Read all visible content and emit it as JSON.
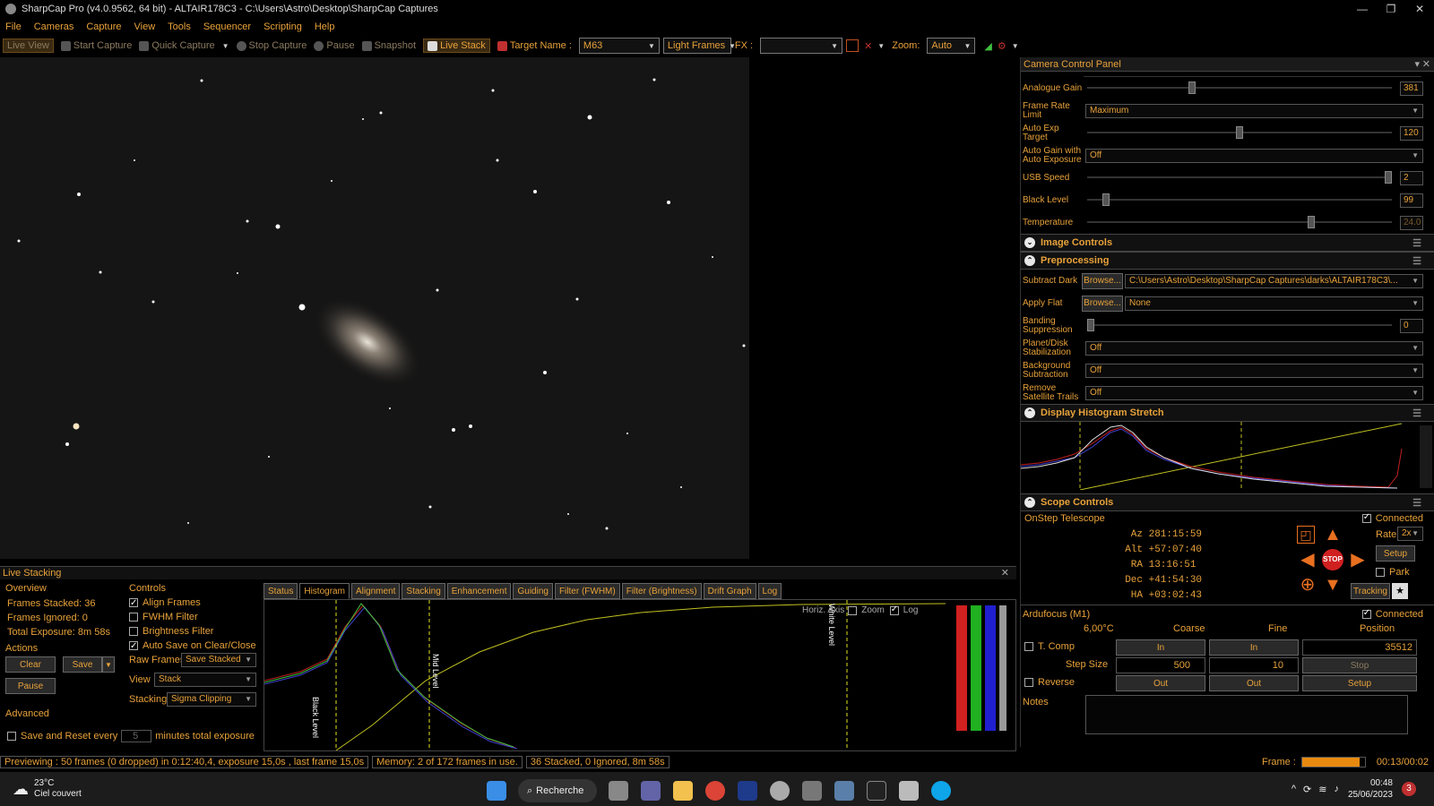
{
  "window": {
    "title": "SharpCap Pro (v4.0.9562, 64 bit) - ALTAIR178C3 - C:\\Users\\Astro\\Desktop\\SharpCap Captures",
    "controls": [
      "—",
      "❐",
      "✕"
    ]
  },
  "menu": [
    "File",
    "Cameras",
    "Capture",
    "View",
    "Tools",
    "Sequencer",
    "Scripting",
    "Help"
  ],
  "toolbar": {
    "live_view": "Live View",
    "start_capture": "Start Capture",
    "quick_capture": "Quick Capture",
    "stop_capture": "Stop Capture",
    "pause": "Pause",
    "snapshot": "Snapshot",
    "live_stack": "Live Stack",
    "target_label": "Target Name :",
    "target_value": "M63",
    "frame_type": "Light Frames",
    "fx_label": "FX :",
    "fx_value": "",
    "zoom_label": "Zoom:",
    "zoom_value": "Auto"
  },
  "camera_panel": {
    "title": "Camera Control Panel",
    "analogue_gain": {
      "label": "Analogue Gain",
      "value": "381",
      "level": 0.34
    },
    "frame_rate": {
      "label": "Frame Rate Limit",
      "value": "Maximum"
    },
    "auto_exp": {
      "label": "Auto Exp Target",
      "value": "120",
      "level": 0.5
    },
    "auto_gain": {
      "label": "Auto Gain with Auto Exposure",
      "value": "Off"
    },
    "usb_speed": {
      "label": "USB Speed",
      "value": "2",
      "level": 1.0
    },
    "black_level": {
      "label": "Black Level",
      "value": "99",
      "level": 0.05
    },
    "temperature": {
      "label": "Temperature",
      "value": "24.0",
      "level": 0.74
    }
  },
  "image_controls": {
    "title": "Image Controls"
  },
  "preprocessing": {
    "title": "Preprocessing",
    "subtract_dark": {
      "label": "Subtract Dark",
      "button": "Browse...",
      "value": "C:\\Users\\Astro\\Desktop\\SharpCap Captures\\darks\\ALTAIR178C3\\..."
    },
    "apply_flat": {
      "label": "Apply Flat",
      "button": "Browse...",
      "value": "None"
    },
    "banding": {
      "label": "Banding Suppression",
      "value": "0",
      "level": 0.0
    },
    "planet": {
      "label": "Planet/Disk Stabilization",
      "value": "Off"
    },
    "background": {
      "label": "Background Subtraction",
      "value": "Off"
    },
    "satellite": {
      "label": "Remove Satellite Trails",
      "value": "Off"
    }
  },
  "histogram_stretch": {
    "title": "Display Histogram Stretch"
  },
  "scope": {
    "title": "Scope Controls",
    "telescope": "OnStep Telescope",
    "connected": "Connected",
    "az_label": "Az",
    "az": "281:15:59",
    "alt_label": "Alt",
    "alt": "+57:07:40",
    "ra_label": "RA",
    "ra": "13:16:51",
    "dec_label": "Dec",
    "dec": "+41:54:30",
    "ha_label": "HA",
    "ha": "+03:02:43",
    "rate_label": "Rate:",
    "rate": "2x",
    "setup": "Setup",
    "park": "Park",
    "tracking": "Tracking",
    "stop": "STOP"
  },
  "focuser": {
    "title": "Ardufocus (M1)",
    "connected": "Connected",
    "temp": "6,00°C",
    "coarse": "Coarse",
    "fine": "Fine",
    "position": "Position",
    "tcomp": "T. Comp",
    "in": "In",
    "position_value": "35512",
    "step_size_label": "Step Size",
    "coarse_step": "500",
    "fine_step": "10",
    "stop": "Stop",
    "reverse": "Reverse",
    "out": "Out",
    "setup": "Setup",
    "notes": "Notes"
  },
  "live_stacking": {
    "title": "Live Stacking",
    "overview": "Overview",
    "frames_stacked": "Frames Stacked: 36",
    "frames_ignored": "Frames Ignored: 0",
    "total_exposure": "Total Exposure:  8m 58s",
    "actions": "Actions",
    "clear": "Clear",
    "save": "Save",
    "pause": "Pause",
    "advanced": "Advanced",
    "save_reset_label": "Save and Reset every",
    "save_reset_value": "5",
    "save_reset_suffix": "minutes total exposure",
    "controls": "Controls",
    "align_frames": "Align Frames",
    "fwhm_filter": "FWHM Filter",
    "brightness_filter": "Brightness Filter",
    "auto_save": "Auto Save on Clear/Close",
    "raw_frames_label": "Raw Frames",
    "raw_frames_value": "Save Stacked",
    "view_label": "View",
    "view_value": "Stack",
    "stacking_label": "Stacking",
    "stacking_value": "Sigma Clipping",
    "tabs": [
      "Status",
      "Histogram",
      "Alignment",
      "Stacking",
      "Enhancement",
      "Guiding",
      "Filter (FWHM)",
      "Filter (Brightness)",
      "Drift Graph",
      "Log"
    ],
    "horiz_axis": "Horiz. Axis",
    "zoom": "Zoom",
    "log": "Log",
    "black_level": "Black Level",
    "mid_level": "Mid Level",
    "white_level": "White Level"
  },
  "status": {
    "preview": "Previewing : 50 frames (0 dropped) in 0:12:40,4, exposure 15,0s , last frame 15,0s",
    "memory": "Memory: 2 of 172 frames in use.",
    "stacked": "36 Stacked, 0 Ignored, 8m 58s",
    "frame_label": "Frame :",
    "frame_time": "00:13/00:02",
    "frame_progress": 0.92
  },
  "taskbar": {
    "temp": "23°C",
    "weather": "Ciel couvert",
    "search": "Recherche",
    "time": "00:48",
    "date": "25/06/2023",
    "badge": "3"
  }
}
